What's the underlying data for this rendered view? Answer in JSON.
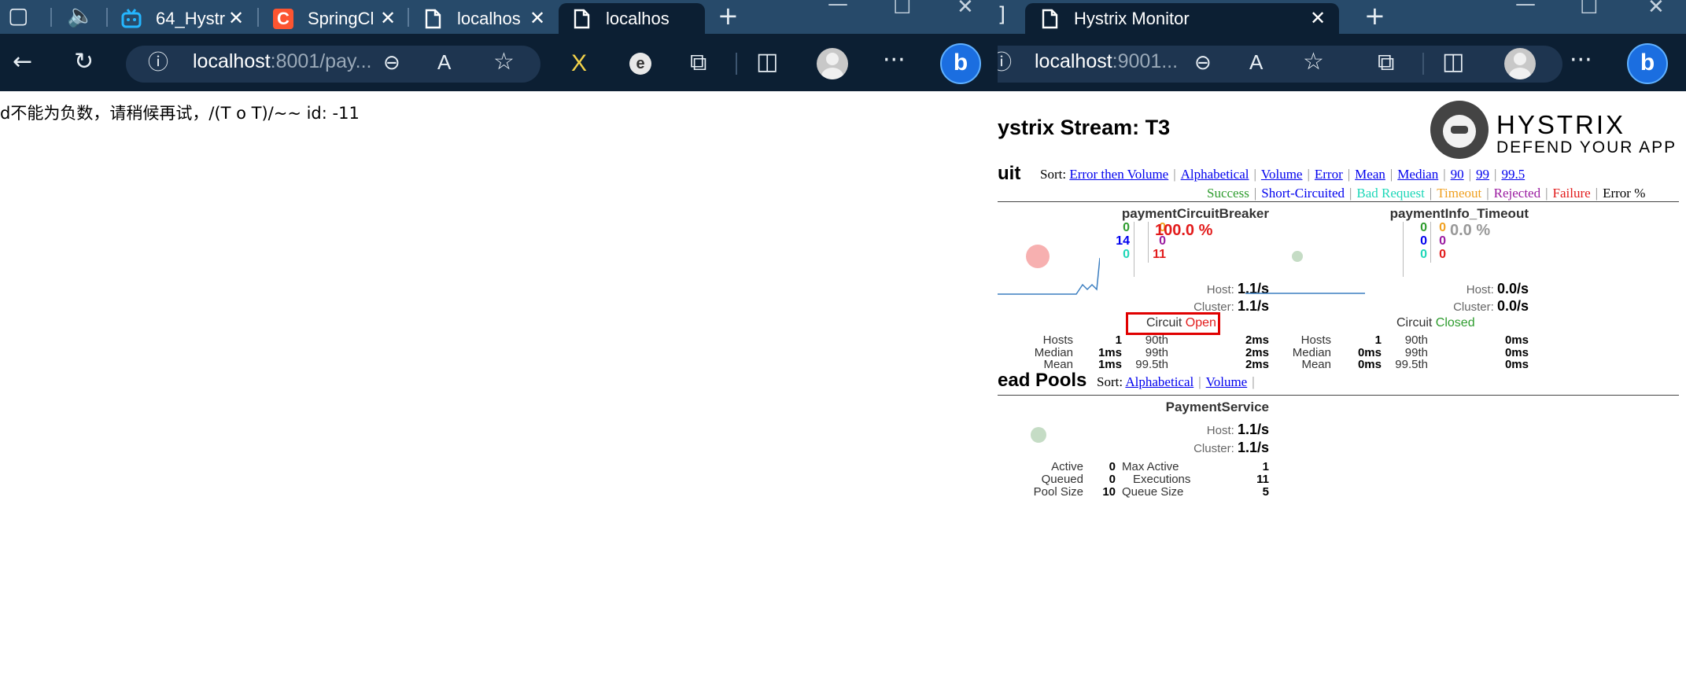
{
  "left_browser": {
    "tabs": [
      {
        "label": "64_Hystr",
        "icon": "bilibili-tv-icon"
      },
      {
        "label": "SpringCl",
        "icon": "c-logo-icon"
      },
      {
        "label": "localhos",
        "icon": "page-icon"
      },
      {
        "label": "localhos",
        "icon": "page-icon"
      }
    ],
    "url_host": "localhost",
    "url_rest": ":8001/pay...",
    "page_text": "d不能为负数，请稍候再试，/(T o T)/~~ id: -11"
  },
  "right_browser": {
    "tab": {
      "label": "Hystrix Monitor",
      "icon": "page-icon"
    },
    "url_host": "localhost",
    "url_rest": ":9001..."
  },
  "hystrix": {
    "stream_title": "ystrix Stream: T3",
    "brand": "HYSTRIX",
    "tagline": "DEFEND YOUR APP",
    "circuit_section": "uit",
    "sort_label": "Sort:",
    "sort_links": [
      "Error then Volume",
      "Alphabetical",
      "Volume",
      "Error",
      "Mean",
      "Median",
      "90",
      "99",
      "99.5"
    ],
    "legend": [
      {
        "label": "Success",
        "color": "#2e9c2e"
      },
      {
        "label": "Short-Circuited",
        "color": "#0000ee"
      },
      {
        "label": "Bad Request",
        "color": "#1ed7b8"
      },
      {
        "label": "Timeout",
        "color": "#f0a020"
      },
      {
        "label": "Rejected",
        "color": "#9a1aa0"
      },
      {
        "label": "Failure",
        "color": "#e21b1b"
      },
      {
        "label": "Error %",
        "color": "#000000"
      }
    ],
    "circuits": [
      {
        "name": "paymentCircuitBreaker",
        "success": "0",
        "short_circuited": "14",
        "bad_request": "0",
        "timeout": "0",
        "rejected": "0",
        "failure": "11",
        "error_pct": "100.0 %",
        "host_label": "Host:",
        "host": "1.1/s",
        "cluster_label": "Cluster:",
        "cluster": "1.1/s",
        "circuit_label": "Circuit",
        "circuit_state": "Open",
        "hosts_label": "Hosts",
        "hosts": "1",
        "median_label": "Median",
        "median": "1ms",
        "mean_label": "Mean",
        "mean": "1ms",
        "p90_label": "90th",
        "p90": "2ms",
        "p99_label": "99th",
        "p99": "2ms",
        "p995_label": "99.5th",
        "p995": "2ms"
      },
      {
        "name": "paymentInfo_Timeout",
        "success": "0",
        "short_circuited": "0",
        "bad_request": "0",
        "timeout": "0",
        "rejected": "0",
        "failure": "0",
        "error_pct": "0.0 %",
        "host_label": "Host:",
        "host": "0.0/s",
        "cluster_label": "Cluster:",
        "cluster": "0.0/s",
        "circuit_label": "Circuit",
        "circuit_state": "Closed",
        "hosts_label": "Hosts",
        "hosts": "1",
        "median_label": "Median",
        "median": "0ms",
        "mean_label": "Mean",
        "mean": "0ms",
        "p90_label": "90th",
        "p90": "0ms",
        "p99_label": "99th",
        "p99": "0ms",
        "p995_label": "99.5th",
        "p995": "0ms"
      }
    ],
    "threadpool_section": "ead Pools",
    "threadpool_sort_links": [
      "Alphabetical",
      "Volume"
    ],
    "threadpool": {
      "name": "PaymentService",
      "host_label": "Host:",
      "host": "1.1/s",
      "cluster_label": "Cluster:",
      "cluster": "1.1/s",
      "active_label": "Active",
      "active": "0",
      "queued_label": "Queued",
      "queued": "0",
      "pool_size_label": "Pool Size",
      "pool_size": "10",
      "max_active_label": "Max Active",
      "max_active": "1",
      "executions_label": "Executions",
      "executions": "11",
      "queue_size_label": "Queue Size",
      "queue_size": "5"
    }
  }
}
